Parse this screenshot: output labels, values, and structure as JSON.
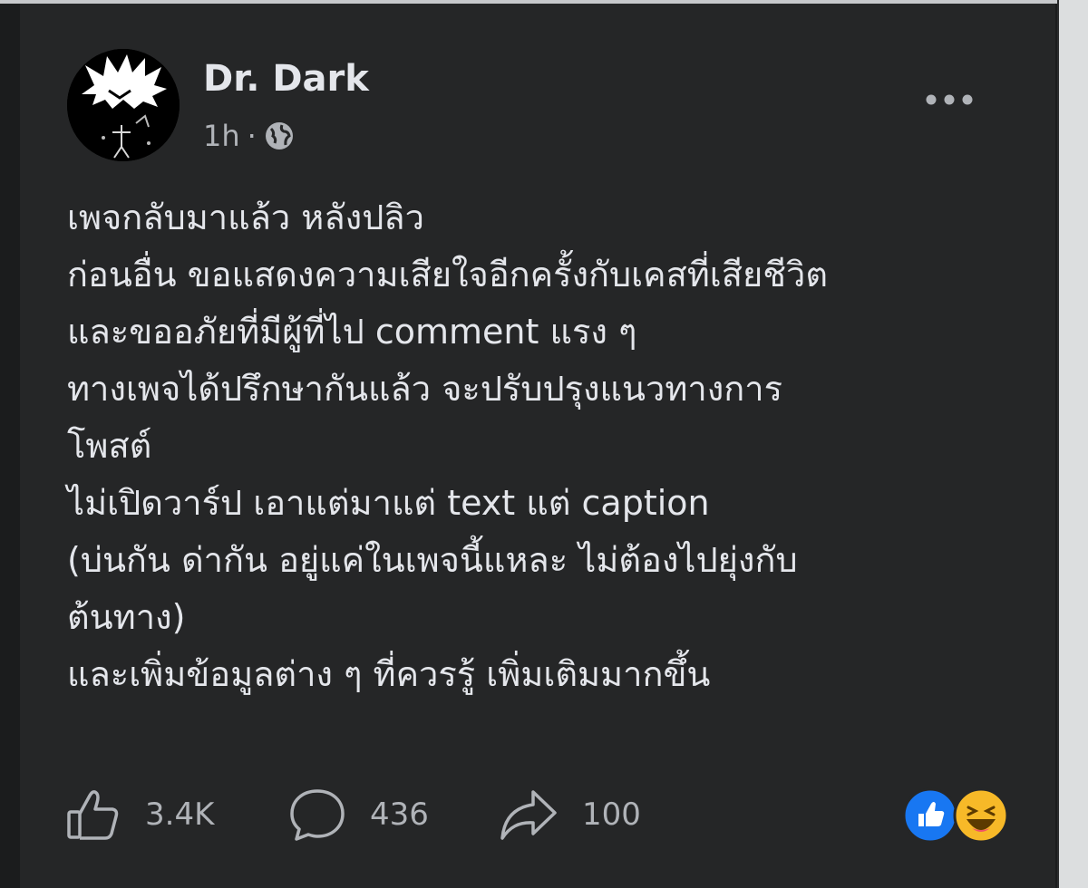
{
  "post": {
    "author": "Dr. Dark",
    "time": "1h",
    "separator": "·",
    "privacy_icon": "globe-icon",
    "menu_icon": "more-options-icon",
    "lines": [
      "เพจกลับมาแล้ว หลังปลิว",
      "ก่อนอื่น ขอแสดงความเสียใจอีกครั้งกับเคสที่เสียชีวิต",
      "และขออภัยที่มีผู้ที่ไป comment แรง ๆ",
      "ทางเพจได้ปรึกษากันแล้ว จะปรับปรุงแนวทางการ",
      "โพสต์",
      "ไม่เปิดวาร์ป เอาแต่มาแต่ text แต่ caption",
      "(บ่นกัน ด่ากัน อยู่แค่ในเพจนี้แหละ ไม่ต้องไปยุ่งกับ",
      "ต้นทาง)",
      "และเพิ่มข้อมูลต่าง ๆ ที่ควรรู้ เพิ่มเติมมากขึ้น"
    ]
  },
  "actions": {
    "likes": "3.4K",
    "comments": "436",
    "shares": "100",
    "like_icon": "thumbs-up-icon",
    "comment_icon": "comment-bubble-icon",
    "share_icon": "share-arrow-icon"
  },
  "reactions": [
    "like-reaction",
    "haha-reaction"
  ],
  "colors": {
    "background": "#252627",
    "text": "#e4e6eb",
    "secondary_text": "#b0b3b8",
    "like_blue": "#1877f2",
    "haha_yellow": "#f7b928"
  }
}
